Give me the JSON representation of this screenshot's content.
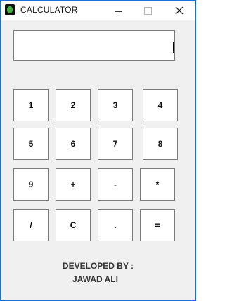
{
  "window": {
    "title": "CALCULATOR"
  },
  "display": {
    "value": ""
  },
  "keys": {
    "row1": [
      "1",
      "2",
      "3",
      "4"
    ],
    "row2": [
      "5",
      "6",
      "7",
      "8"
    ],
    "row3": [
      "9",
      "+",
      "-",
      "*"
    ],
    "row4": [
      "/",
      "C",
      ".",
      "="
    ]
  },
  "footer": {
    "line1": "DEVELOPED BY :",
    "line2": "JAWAD ALI"
  }
}
